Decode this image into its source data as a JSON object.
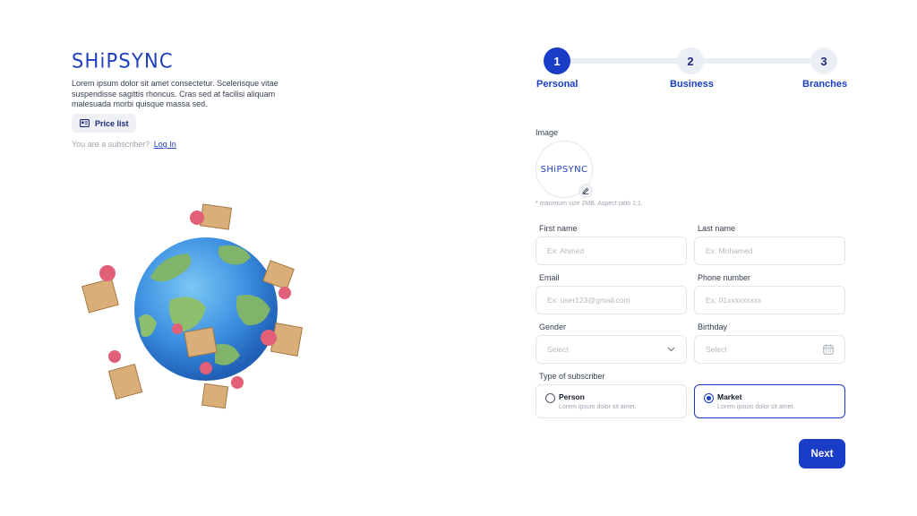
{
  "brand": {
    "logo_text": "SHiPSYNC",
    "description": "Lorem ipsum dolor sit amet consectetur. Scelerisque vitae suspendisse sagittis rhoncus. Cras sed at facilisi aliquam malesuada morbi quisque massa sed.",
    "price_list_label": "Price list",
    "subscriber_prompt": "You are a subscriber?",
    "login_link": "Log In"
  },
  "stepper": {
    "steps": [
      {
        "number": "1",
        "label": "Personal",
        "active": true
      },
      {
        "number": "2",
        "label": "Business",
        "active": false
      },
      {
        "number": "3",
        "label": "Branches",
        "active": false
      }
    ]
  },
  "form": {
    "image_label": "Image",
    "avatar_text": "SHiPSYNC",
    "image_hint": "* maximum size 2MB. Aspect ratio 1:1.",
    "first_name": {
      "label": "First name",
      "placeholder": "Ex: Ahmed"
    },
    "last_name": {
      "label": "Last name",
      "placeholder": "Ex: Mohamed"
    },
    "email": {
      "label": "Email",
      "placeholder": "Ex: user123@gmail.com"
    },
    "phone": {
      "label": "Phone number",
      "placeholder": "Ex: 01xxxxxxxxx"
    },
    "gender": {
      "label": "Gender",
      "placeholder": "Select"
    },
    "birthday": {
      "label": "Birthday",
      "placeholder": "Select"
    },
    "subscriber_type": {
      "label": "Type of subscriber",
      "options": [
        {
          "title": "Person",
          "subtitle": "Lorem ipsum dolor sit amet.",
          "selected": false
        },
        {
          "title": "Market",
          "subtitle": "Lorem ipsum dolor sit amet.",
          "selected": true
        }
      ]
    },
    "next_label": "Next"
  },
  "colors": {
    "accent": "#1a3dc8",
    "step_inactive": "#eceef5",
    "border": "#e3e5ea"
  }
}
